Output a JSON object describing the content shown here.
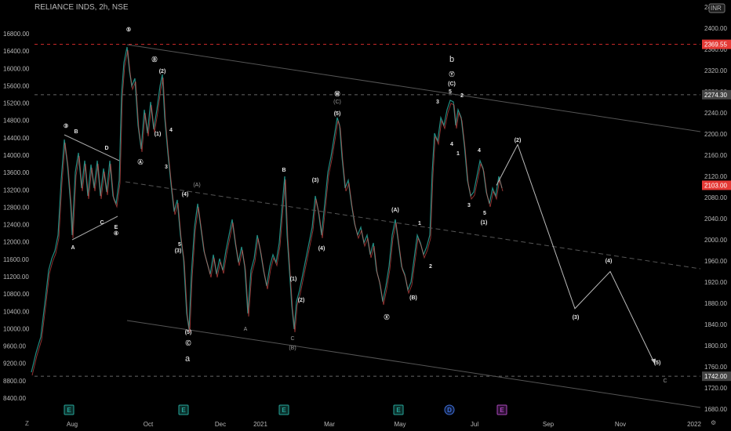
{
  "header": {
    "symbol": "RELIANCE INDS, 2h, NSE"
  },
  "right_top_label": "24",
  "currency_badge": "INR",
  "left_axis_ticks": [
    "16800.00",
    "16400.00",
    "16000.00",
    "15600.00",
    "15200.00",
    "14800.00",
    "14400.00",
    "14000.00",
    "13600.00",
    "13200.00",
    "12800.00",
    "12400.00",
    "12000.00",
    "11600.00",
    "11200.00",
    "10800.00",
    "10400.00",
    "10000.00",
    "9600.00",
    "9200.00",
    "8800.00",
    "8400.00"
  ],
  "right_axis_ticks": [
    "2400.00",
    "2360.00",
    "2320.00",
    "2280.00",
    "2240.00",
    "2200.00",
    "2160.00",
    "2120.00",
    "2080.00",
    "2040.00",
    "2000.00",
    "1960.00",
    "1920.00",
    "1880.00",
    "1840.00",
    "1800.00",
    "1760.00",
    "1720.00",
    "1680.00"
  ],
  "x_axis_labels": [
    "Aug",
    "Oct",
    "Dec",
    "2021",
    "Mar",
    "May",
    "Jul",
    "Sep",
    "Nov",
    "2022"
  ],
  "price_tags": [
    {
      "value": "2369.55",
      "color": "#e53935"
    },
    {
      "value": "2274.30",
      "color": "#444444"
    },
    {
      "value": "2103.00",
      "color": "#e53935"
    },
    {
      "value": "1742.00",
      "color": "#444444"
    }
  ],
  "corner_buttons": {
    "left": "Z",
    "right": "⚙"
  },
  "chart_data": {
    "type": "line",
    "title": "RELIANCE INDS, 2h, NSE",
    "series": [],
    "x": [
      "Aug",
      "Oct",
      "Dec",
      "2021",
      "Mar",
      "May",
      "Jul",
      "Sep",
      "Nov",
      "2022"
    ],
    "left_axis_range": [
      8400,
      16800
    ],
    "right_axis_range": [
      1680,
      2400
    ],
    "horizontal_levels_right_axis": [
      2369.55,
      2274.3,
      1742.0
    ],
    "last_price_right_axis": 2103.0,
    "projection_points_right_axis": [
      {
        "label": "(2)",
        "value": 2180
      },
      {
        "label": "(3)",
        "value": 1870
      },
      {
        "label": "(4)",
        "value": 1940
      },
      {
        "label": "(5)",
        "value": 1765
      }
    ],
    "wave_labels": [
      "a",
      "b",
      "C",
      "(1)",
      "(2)",
      "(3)",
      "(4)",
      "(5)",
      "A",
      "B",
      "C",
      "D",
      "E",
      "Ⓐ",
      "Ⓑ",
      "Ⓒ",
      "Ⓦ",
      "Ⓧ",
      "Ⓨ",
      "③",
      "④",
      "⑤"
    ],
    "event_markers": [
      "E",
      "E",
      "E",
      "E",
      "D",
      "E"
    ],
    "grid": false,
    "legend": "none"
  }
}
